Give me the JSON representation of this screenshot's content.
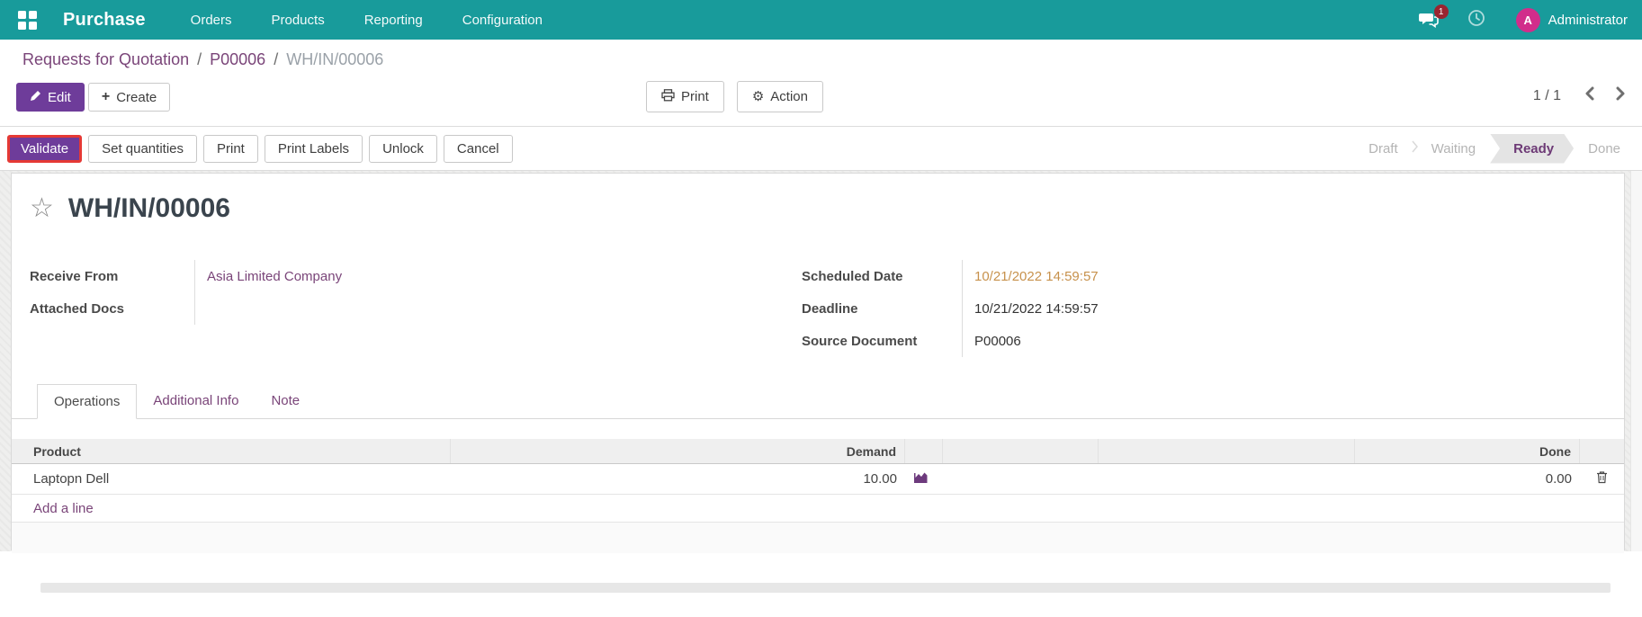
{
  "navbar": {
    "app_name": "Purchase",
    "menus": [
      "Orders",
      "Products",
      "Reporting",
      "Configuration"
    ],
    "message_count": "1",
    "user_initial": "A",
    "user_name": "Administrator"
  },
  "breadcrumb": {
    "separator": "/",
    "items": [
      "Requests for Quotation",
      "P00006",
      "WH/IN/00006"
    ]
  },
  "control_panel": {
    "edit": "Edit",
    "create": "Create",
    "print": "Print",
    "action": "Action",
    "pager": "1 / 1"
  },
  "statusbar": {
    "buttons": [
      "Validate",
      "Set quantities",
      "Print",
      "Print Labels",
      "Unlock",
      "Cancel"
    ],
    "highlighted_button": "Validate",
    "states": [
      "Draft",
      "Waiting",
      "Ready",
      "Done"
    ],
    "active_state": "Ready"
  },
  "form": {
    "title": "WH/IN/00006",
    "fields": {
      "receive_from_label": "Receive From",
      "receive_from_value": "Asia Limited Company",
      "attached_docs_label": "Attached Docs",
      "attached_docs_value": "",
      "scheduled_date_label": "Scheduled Date",
      "scheduled_date_value": "10/21/2022 14:59:57",
      "deadline_label": "Deadline",
      "deadline_value": "10/21/2022 14:59:57",
      "source_document_label": "Source Document",
      "source_document_value": "P00006"
    },
    "tabs": [
      "Operations",
      "Additional Info",
      "Note"
    ],
    "table": {
      "product_header": "Product",
      "demand_header": "Demand",
      "done_header": "Done",
      "rows": [
        {
          "product": "Laptopn Dell",
          "demand": "10.00",
          "done": "0.00"
        }
      ],
      "add_line": "Add a line"
    }
  },
  "colors": {
    "navbar_teal": "#189b9b",
    "primary_button_purple": "#6e3c9a",
    "link_purple": "#7a4579",
    "highlight_red": "#e53935",
    "late_date_orange": "#c7914c",
    "avatar_pink": "#d12d8b",
    "badge_maroon": "#9a2430",
    "active_state_purple": "#6d3a76"
  }
}
